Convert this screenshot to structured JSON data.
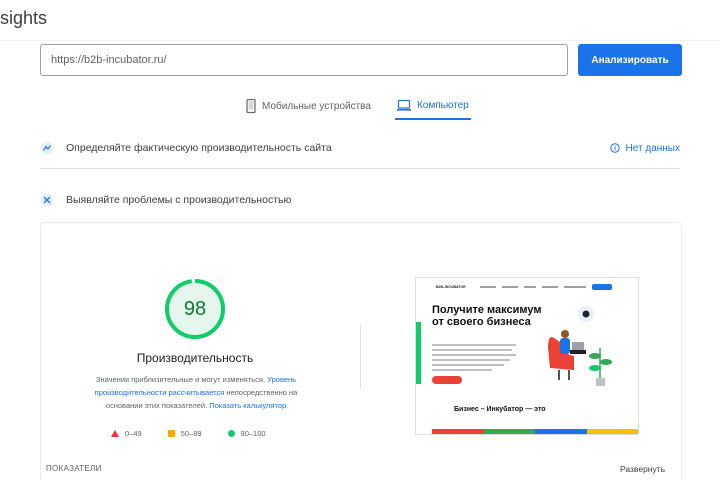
{
  "header": {
    "title": "sights"
  },
  "search": {
    "url_value": "https://b2b-incubator.ru/",
    "analyze_label": "Анализировать"
  },
  "tabs": [
    {
      "label": "Мобильные устройства",
      "icon": "mobile-icon",
      "active": false
    },
    {
      "label": "Компьютер",
      "icon": "desktop-icon",
      "active": true
    }
  ],
  "field_data": {
    "text": "Определяйте фактическую производительность сайта",
    "status": "Нет данных"
  },
  "lab_data": {
    "text": "Выявляйте проблемы с производительностью"
  },
  "performance": {
    "score": "98",
    "score_value": 98,
    "label": "Производительность",
    "desc_part1": "Значения приблизительные и могут изменяться. ",
    "desc_link1": "Уровень производительности рассчитывается",
    "desc_part2": " непосредственно на основании этих показателей. ",
    "desc_link2": "Показать калькулятор",
    "legend": [
      {
        "range": "0–49",
        "color": "#e53935"
      },
      {
        "range": "50–89",
        "color": "#ffa400"
      },
      {
        "range": "90–100",
        "color": "#0cce6b"
      }
    ]
  },
  "screenshot": {
    "site_logo": "B2B–INCUBATOR",
    "hero_title": "Получите максимум от своего бизнеса",
    "subtitle": "Бизнес – Инкубатор — это"
  },
  "footer": {
    "metrics_label": "ПОКАЗАТЕЛИ",
    "expand_label": "Развернуть"
  },
  "colors": {
    "accent": "#1a73e8",
    "pass": "#0cce6b",
    "average": "#ffa400",
    "fail": "#e53935"
  }
}
